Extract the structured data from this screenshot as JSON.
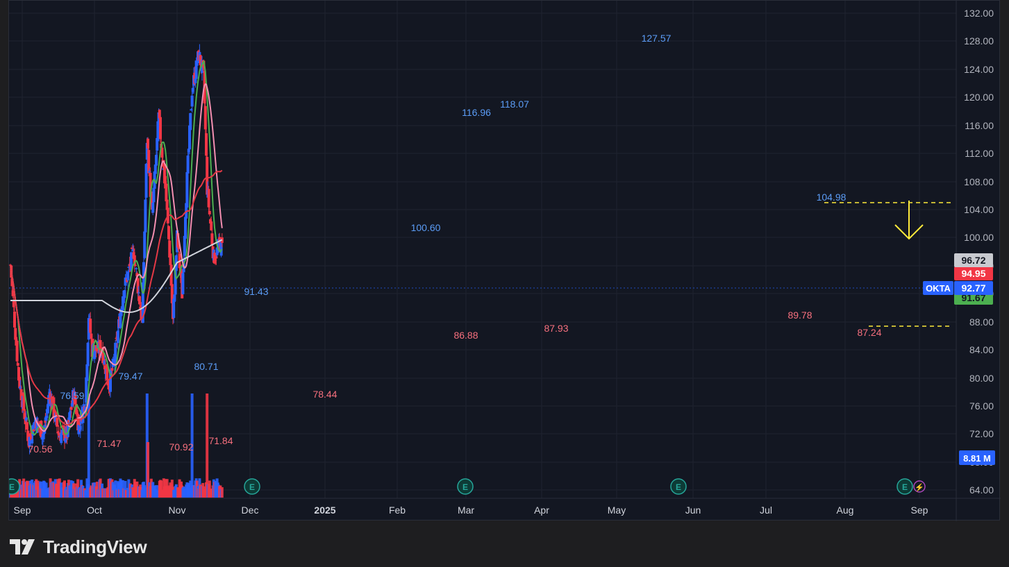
{
  "brand": {
    "name": "TradingView"
  },
  "chart_data": {
    "type": "candlestick",
    "symbol": "OKTA",
    "last_price": "92.77",
    "volume_label": "8.81 M",
    "y_axis": {
      "ticks": [
        "132.00",
        "128.00",
        "124.00",
        "120.00",
        "116.00",
        "112.00",
        "108.00",
        "104.00",
        "100.00",
        "96.00",
        "92.00",
        "88.00",
        "84.00",
        "80.00",
        "76.00",
        "72.00",
        "68.00",
        "64.00"
      ],
      "range": [
        63.0,
        133.0
      ]
    },
    "x_axis": {
      "labels": [
        "Sep",
        "Oct",
        "Nov",
        "Dec",
        "2025",
        "Feb",
        "Mar",
        "Apr",
        "May",
        "Jun",
        "Jul",
        "Aug",
        "Sep"
      ]
    },
    "price_tags": [
      {
        "value": "96.72",
        "kind": "ma200"
      },
      {
        "value": "94.95",
        "kind": "ma50"
      },
      {
        "value": "92.77",
        "kind": "last"
      },
      {
        "value": "91.67",
        "kind": "ma10"
      }
    ],
    "pivot_labels": [
      {
        "text": "70.56",
        "kind": "low"
      },
      {
        "text": "76.59",
        "kind": "high"
      },
      {
        "text": "71.47",
        "kind": "low"
      },
      {
        "text": "79.47",
        "kind": "high"
      },
      {
        "text": "70.92",
        "kind": "low"
      },
      {
        "text": "80.71",
        "kind": "high"
      },
      {
        "text": "71.84",
        "kind": "low"
      },
      {
        "text": "91.43",
        "kind": "high"
      },
      {
        "text": "78.44",
        "kind": "low"
      },
      {
        "text": "100.60",
        "kind": "high"
      },
      {
        "text": "86.88",
        "kind": "low"
      },
      {
        "text": "116.96",
        "kind": "high"
      },
      {
        "text": "118.07",
        "kind": "high"
      },
      {
        "text": "87.93",
        "kind": "low"
      },
      {
        "text": "127.57",
        "kind": "high"
      },
      {
        "text": "89.78",
        "kind": "low"
      },
      {
        "text": "104.98",
        "kind": "high"
      },
      {
        "text": "87.24",
        "kind": "low"
      }
    ],
    "earnings_markers": [
      "E",
      "E",
      "E",
      "E",
      "E"
    ],
    "colors": {
      "up": "#2962ff",
      "down": "#f23645",
      "ma_short": "#4caf50",
      "ma_mid": "#f48fb1",
      "ma_long": "#e53946",
      "ma_200": "#d1d4dc",
      "annotation": "#ffeb3b",
      "background": "#131722",
      "grid": "#1f2330"
    }
  }
}
